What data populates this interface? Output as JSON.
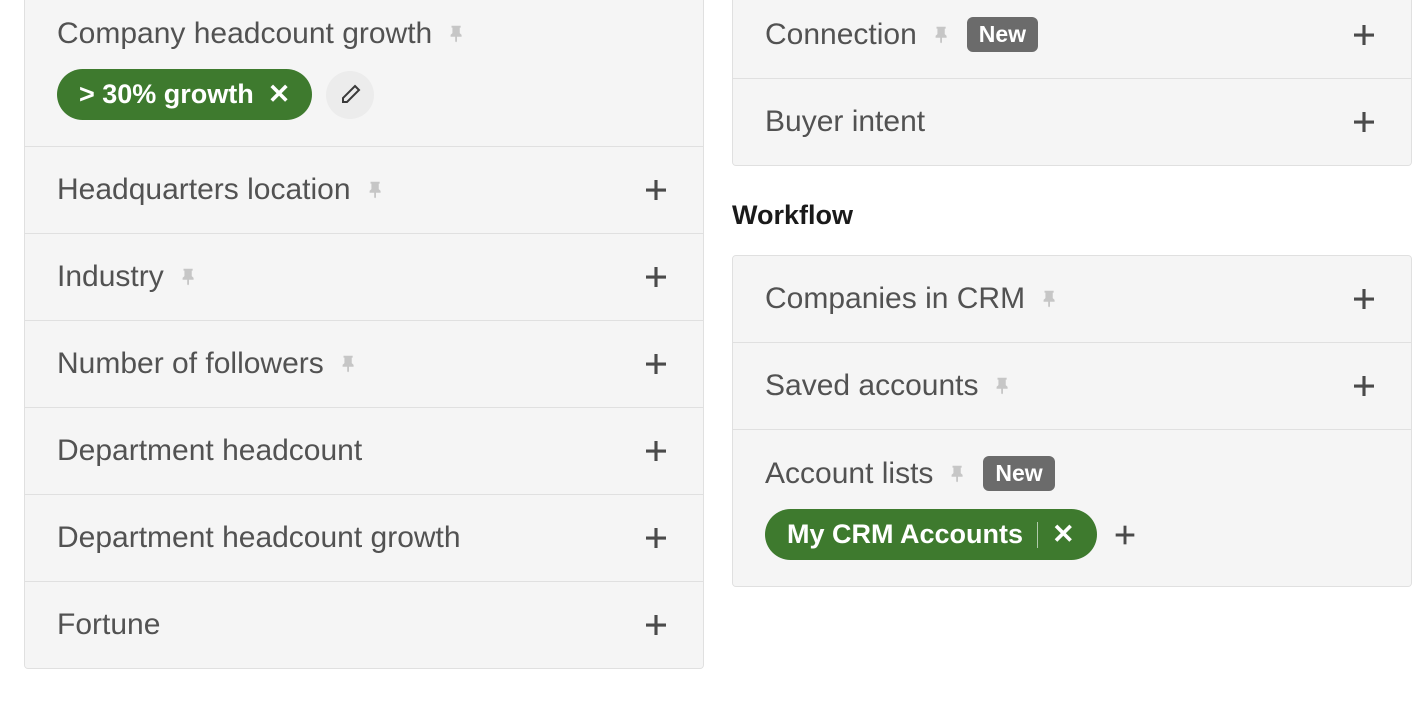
{
  "badges": {
    "new": "New"
  },
  "left": {
    "filters": [
      {
        "label": "Company headcount growth",
        "pinned": true,
        "chip": "> 30% growth",
        "editable": true
      },
      {
        "label": "Headquarters location",
        "pinned": true,
        "add": true
      },
      {
        "label": "Industry",
        "pinned": true,
        "add": true
      },
      {
        "label": "Number of followers",
        "pinned": true,
        "add": true
      },
      {
        "label": "Department headcount",
        "pinned": false,
        "add": true
      },
      {
        "label": "Department headcount growth",
        "pinned": false,
        "add": true
      },
      {
        "label": "Fortune",
        "pinned": false,
        "add": true
      }
    ]
  },
  "right": {
    "filters_top": [
      {
        "label": "Connection",
        "pinned": true,
        "new_badge": true,
        "add": true
      },
      {
        "label": "Buyer intent",
        "pinned": false,
        "add": true
      }
    ],
    "section_title": "Workflow",
    "filters_workflow": [
      {
        "label": "Companies in CRM",
        "pinned": true,
        "add": true
      },
      {
        "label": "Saved accounts",
        "pinned": true,
        "add": true
      },
      {
        "label": "Account lists",
        "pinned": true,
        "new_badge": true,
        "chip": "My CRM Accounts",
        "inline_add": true
      }
    ]
  }
}
